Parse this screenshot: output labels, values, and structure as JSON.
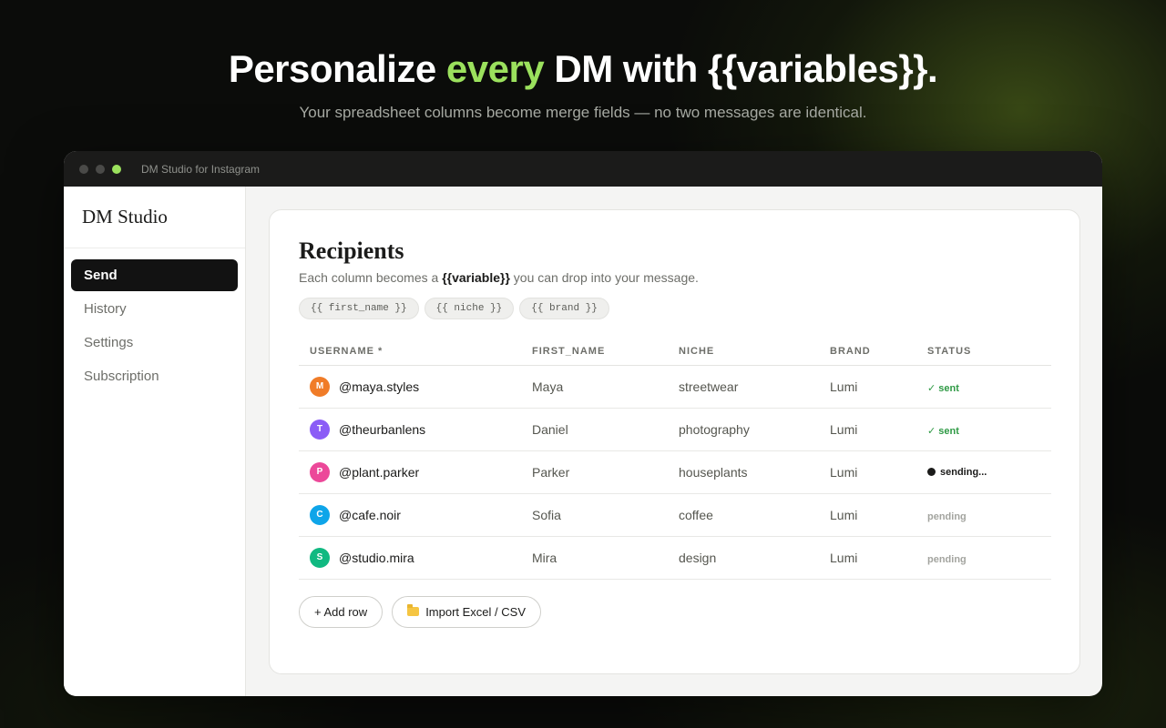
{
  "hero": {
    "title_pre": "Personalize ",
    "title_accent": "every",
    "title_post": " DM with {{variables}}.",
    "subtitle": "Your spreadsheet columns become merge fields — no two messages are identical."
  },
  "window": {
    "title": "DM Studio for Instagram"
  },
  "sidebar": {
    "brand": "DM Studio",
    "items": [
      {
        "label": "Send",
        "active": true
      },
      {
        "label": "History"
      },
      {
        "label": "Settings"
      },
      {
        "label": "Subscription"
      }
    ]
  },
  "recipients": {
    "title": "Recipients",
    "desc_pre": "Each column becomes a ",
    "desc_var": "{{variable}}",
    "desc_post": " you can drop into your message.",
    "chips": [
      "{{ first_name }}",
      "{{ niche }}",
      "{{ brand }}"
    ],
    "columns": [
      "USERNAME *",
      "FIRST_NAME",
      "NICHE",
      "BRAND",
      "STATUS"
    ],
    "rows": [
      {
        "initial": "M",
        "avatar_color": "#f07c28",
        "username": "@maya.styles",
        "first_name": "Maya",
        "niche": "streetwear",
        "brand": "Lumi",
        "status": "✓ sent"
      },
      {
        "initial": "T",
        "avatar_color": "#8b5cf6",
        "username": "@theurbanlens",
        "first_name": "Daniel",
        "niche": "photography",
        "brand": "Lumi",
        "status": "✓ sent"
      },
      {
        "initial": "P",
        "avatar_color": "#ec4899",
        "username": "@plant.parker",
        "first_name": "Parker",
        "niche": "houseplants",
        "brand": "Lumi",
        "status": "sending..."
      },
      {
        "initial": "C",
        "avatar_color": "#0ea5e9",
        "username": "@cafe.noir",
        "first_name": "Sofia",
        "niche": "coffee",
        "brand": "Lumi",
        "status": "pending"
      },
      {
        "initial": "S",
        "avatar_color": "#10b981",
        "username": "@studio.mira",
        "first_name": "Mira",
        "niche": "design",
        "brand": "Lumi",
        "status": "pending"
      }
    ],
    "add_row_label": "+ Add row",
    "import_label": "Import Excel / CSV"
  },
  "colors": {
    "accent": "#9be15d",
    "sent": "#2f9a45",
    "pending": "#a3a49f"
  }
}
